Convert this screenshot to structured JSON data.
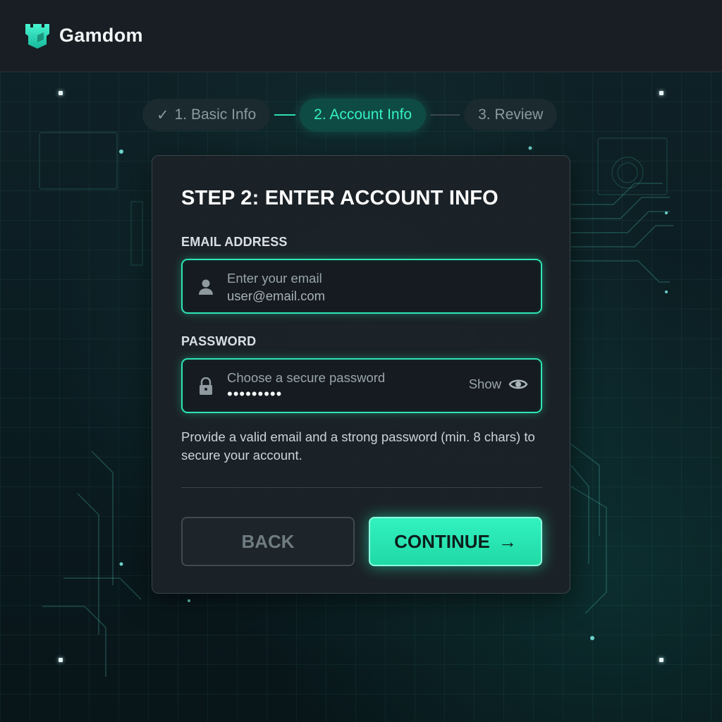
{
  "brand": {
    "name": "Gamdom",
    "logo_icon": "castle-tower-icon",
    "accent": "#2de8b8"
  },
  "stepper": {
    "steps": [
      {
        "label": "1. Basic Info",
        "state": "completed",
        "icon": "check-icon"
      },
      {
        "label": "2. Account Info",
        "state": "active"
      },
      {
        "label": "3. Review",
        "state": "upcoming"
      }
    ]
  },
  "card": {
    "title": "STEP 2: ENTER ACCOUNT INFO",
    "email": {
      "label": "EMAIL ADDRESS",
      "placeholder": "Enter your email",
      "value": "user@email.com",
      "icon": "user-icon"
    },
    "password": {
      "label": "PASSWORD",
      "placeholder": "Choose a secure password",
      "value_masked": "•••••••••",
      "icon": "lock-icon",
      "toggle_label": "Show",
      "toggle_icon": "eye-icon"
    },
    "help_text": "Provide a valid email and a strong password (min. 8 chars) to secure your account.",
    "back_label": "BACK",
    "continue_label": "CONTINUE",
    "continue_icon": "arrow-right-icon"
  }
}
